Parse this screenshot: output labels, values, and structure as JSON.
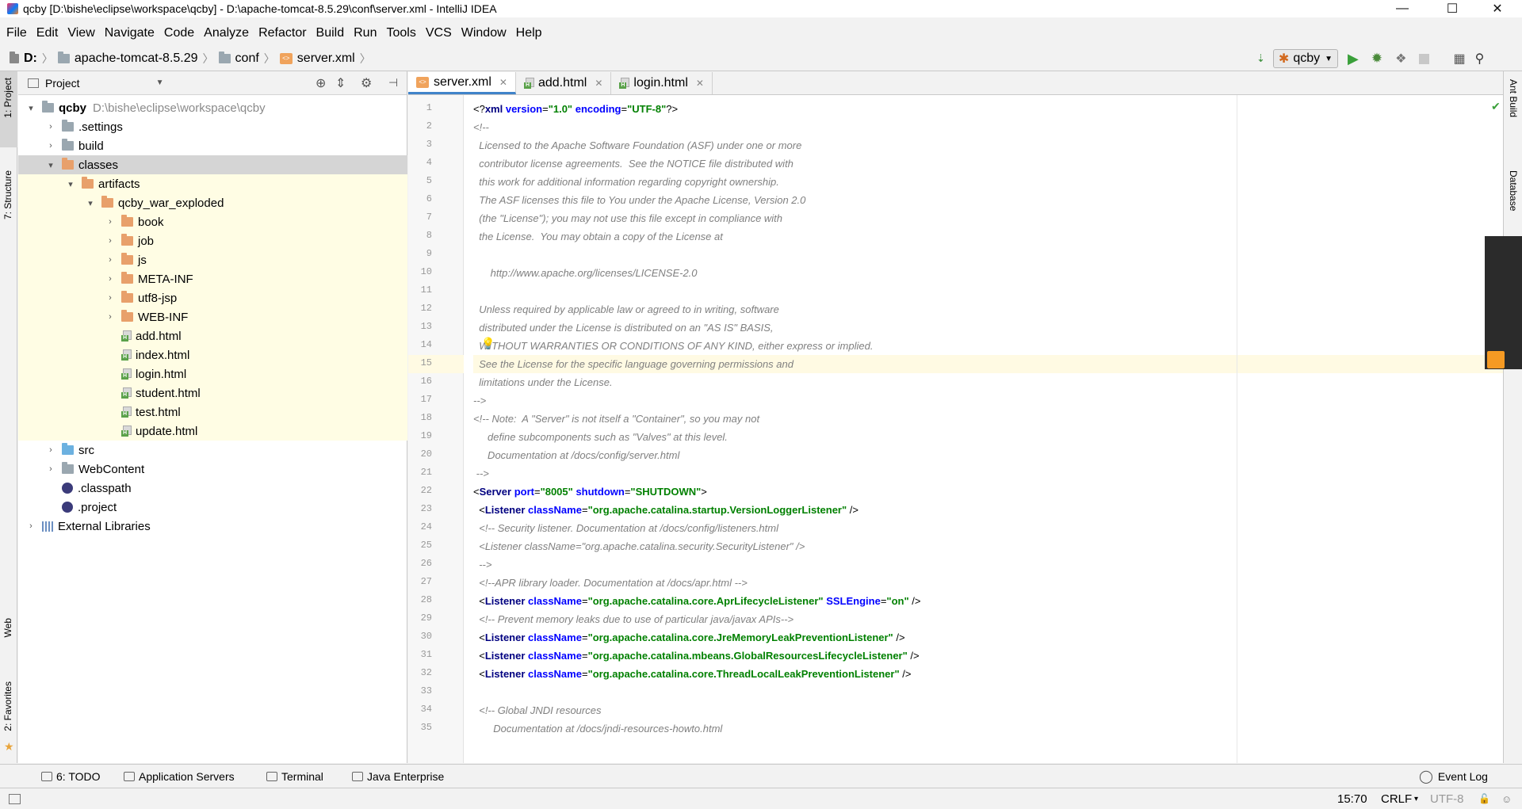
{
  "window": {
    "title": "qcby [D:\\bishe\\eclipse\\workspace\\qcby] - D:\\apache-tomcat-8.5.29\\conf\\server.xml - IntelliJ IDEA",
    "minimize": "—",
    "maximize": "☐",
    "close": "✕"
  },
  "menu": [
    "File",
    "Edit",
    "View",
    "Navigate",
    "Code",
    "Analyze",
    "Refactor",
    "Build",
    "Run",
    "Tools",
    "VCS",
    "Window",
    "Help"
  ],
  "breadcrumb": [
    "D:",
    "apache-tomcat-8.5.29",
    "conf",
    "server.xml"
  ],
  "run_config": "qcby",
  "left_strip": {
    "project": "1: Project",
    "structure": "7: Structure",
    "web": "Web",
    "favorites": "2: Favorites"
  },
  "right_strip": {
    "ant": "Ant Build",
    "database": "Database"
  },
  "project_panel": {
    "title": "Project",
    "tree": [
      {
        "label": "qcby",
        "path": "D:\\bishe\\eclipse\\workspace\\qcby",
        "level": 0,
        "icon": "module-folder-icon",
        "expand": "down",
        "bold": true
      },
      {
        "label": ".settings",
        "level": 1,
        "icon": "folder-icon",
        "expand": "right"
      },
      {
        "label": "build",
        "level": 1,
        "icon": "folder-icon",
        "expand": "right"
      },
      {
        "label": "classes",
        "level": 1,
        "icon": "orange-folder-icon",
        "expand": "down",
        "selected": true
      },
      {
        "label": "artifacts",
        "level": 2,
        "icon": "orange-folder-icon",
        "expand": "down"
      },
      {
        "label": "qcby_war_exploded",
        "level": 3,
        "icon": "orange-folder-icon",
        "expand": "down"
      },
      {
        "label": "book",
        "level": 4,
        "icon": "orange-folder-icon",
        "expand": "right"
      },
      {
        "label": "job",
        "level": 4,
        "icon": "orange-folder-icon",
        "expand": "right"
      },
      {
        "label": "js",
        "level": 4,
        "icon": "orange-folder-icon",
        "expand": "right"
      },
      {
        "label": "META-INF",
        "level": 4,
        "icon": "orange-folder-icon",
        "expand": "right"
      },
      {
        "label": "utf8-jsp",
        "level": 4,
        "icon": "orange-folder-icon",
        "expand": "right"
      },
      {
        "label": "WEB-INF",
        "level": 4,
        "icon": "orange-folder-icon",
        "expand": "right"
      },
      {
        "label": "add.html",
        "level": 4,
        "icon": "html-file-icon"
      },
      {
        "label": "index.html",
        "level": 4,
        "icon": "html-file-icon"
      },
      {
        "label": "login.html",
        "level": 4,
        "icon": "html-file-icon"
      },
      {
        "label": "student.html",
        "level": 4,
        "icon": "html-file-icon"
      },
      {
        "label": "test.html",
        "level": 4,
        "icon": "html-file-icon"
      },
      {
        "label": "update.html",
        "level": 4,
        "icon": "html-file-icon"
      },
      {
        "label": "src",
        "level": 1,
        "icon": "blue-folder-icon",
        "expand": "right"
      },
      {
        "label": "WebContent",
        "level": 1,
        "icon": "folder-icon",
        "expand": "right"
      },
      {
        "label": ".classpath",
        "level": 1,
        "icon": "eclipse-file-icon"
      },
      {
        "label": ".project",
        "level": 1,
        "icon": "eclipse-file-icon"
      },
      {
        "label": "External Libraries",
        "level": 0,
        "icon": "libraries-icon",
        "expand": "right"
      }
    ]
  },
  "tabs": [
    {
      "label": "server.xml",
      "active": true,
      "icon": "xml-file-icon"
    },
    {
      "label": "add.html",
      "active": false,
      "icon": "html-file-icon"
    },
    {
      "label": "login.html",
      "active": false,
      "icon": "html-file-icon"
    }
  ],
  "code_lines": [
    [
      {
        "t": "<?",
        "c": "pl"
      },
      {
        "t": "xml ",
        "c": "tg"
      },
      {
        "t": "version",
        "c": "at"
      },
      {
        "t": "=",
        "c": "pl"
      },
      {
        "t": "\"1.0\"",
        "c": "sv"
      },
      {
        "t": " ",
        "c": "pl"
      },
      {
        "t": "encoding",
        "c": "at"
      },
      {
        "t": "=",
        "c": "pl"
      },
      {
        "t": "\"UTF-8\"",
        "c": "sv"
      },
      {
        "t": "?>",
        "c": "pl"
      }
    ],
    [
      {
        "t": "<!--",
        "c": "cm"
      }
    ],
    [
      {
        "t": "  Licensed to the Apache Software Foundation (ASF) under one or more",
        "c": "cm"
      }
    ],
    [
      {
        "t": "  contributor license agreements.  See the NOTICE file distributed with",
        "c": "cm"
      }
    ],
    [
      {
        "t": "  this work for additional information regarding copyright ownership.",
        "c": "cm"
      }
    ],
    [
      {
        "t": "  The ASF licenses this file to You under the Apache License, Version 2.0",
        "c": "cm"
      }
    ],
    [
      {
        "t": "  (the \"License\"); you may not use this file except in compliance with",
        "c": "cm"
      }
    ],
    [
      {
        "t": "  the License.  You may obtain a copy of the License at",
        "c": "cm"
      }
    ],
    [
      {
        "t": "",
        "c": "cm"
      }
    ],
    [
      {
        "t": "      http://www.apache.org/licenses/LICENSE-2.0",
        "c": "cm"
      }
    ],
    [
      {
        "t": "",
        "c": "cm"
      }
    ],
    [
      {
        "t": "  Unless required by applicable law or agreed to in writing, software",
        "c": "cm"
      }
    ],
    [
      {
        "t": "  distributed under the License is distributed on an \"AS IS\" BASIS,",
        "c": "cm"
      }
    ],
    [
      {
        "t": "  WITHOUT WARRANTIES OR CONDITIONS OF ANY KIND, either express or implied.",
        "c": "cm"
      }
    ],
    [
      {
        "t": "  See the License for the specific language governing permissions and",
        "c": "cm"
      }
    ],
    [
      {
        "t": "  limitations under the License.",
        "c": "cm"
      }
    ],
    [
      {
        "t": "-->",
        "c": "cm"
      }
    ],
    [
      {
        "t": "<!-- Note:  A \"Server\" is not itself a \"Container\", so you may not",
        "c": "cm"
      }
    ],
    [
      {
        "t": "     define subcomponents such as \"Valves\" at this level.",
        "c": "cm"
      }
    ],
    [
      {
        "t": "     Documentation at /docs/config/server.html",
        "c": "cm"
      }
    ],
    [
      {
        "t": " -->",
        "c": "cm"
      }
    ],
    [
      {
        "t": "<",
        "c": "pl"
      },
      {
        "t": "Server ",
        "c": "tg"
      },
      {
        "t": "port",
        "c": "at"
      },
      {
        "t": "=",
        "c": "pl"
      },
      {
        "t": "\"8005\"",
        "c": "sv"
      },
      {
        "t": " ",
        "c": "pl"
      },
      {
        "t": "shutdown",
        "c": "at"
      },
      {
        "t": "=",
        "c": "pl"
      },
      {
        "t": "\"SHUTDOWN\"",
        "c": "sv"
      },
      {
        "t": ">",
        "c": "pl"
      }
    ],
    [
      {
        "t": "  <",
        "c": "pl"
      },
      {
        "t": "Listener ",
        "c": "tg"
      },
      {
        "t": "className",
        "c": "at"
      },
      {
        "t": "=",
        "c": "pl"
      },
      {
        "t": "\"org.apache.catalina.startup.VersionLoggerListener\"",
        "c": "sv"
      },
      {
        "t": " />",
        "c": "pl"
      }
    ],
    [
      {
        "t": "  <!-- Security listener. Documentation at /docs/config/listeners.html",
        "c": "cm"
      }
    ],
    [
      {
        "t": "  <Listener className=\"org.apache.catalina.security.SecurityListener\" />",
        "c": "cm"
      }
    ],
    [
      {
        "t": "  -->",
        "c": "cm"
      }
    ],
    [
      {
        "t": "  <!--APR library loader. Documentation at /docs/apr.html -->",
        "c": "cm"
      }
    ],
    [
      {
        "t": "  <",
        "c": "pl"
      },
      {
        "t": "Listener ",
        "c": "tg"
      },
      {
        "t": "className",
        "c": "at"
      },
      {
        "t": "=",
        "c": "pl"
      },
      {
        "t": "\"org.apache.catalina.core.AprLifecycleListener\"",
        "c": "sv"
      },
      {
        "t": " ",
        "c": "pl"
      },
      {
        "t": "SSLEngine",
        "c": "at"
      },
      {
        "t": "=",
        "c": "pl"
      },
      {
        "t": "\"on\"",
        "c": "sv"
      },
      {
        "t": " />",
        "c": "pl"
      }
    ],
    [
      {
        "t": "  <!-- Prevent memory leaks due to use of particular java/javax APIs-->",
        "c": "cm"
      }
    ],
    [
      {
        "t": "  <",
        "c": "pl"
      },
      {
        "t": "Listener ",
        "c": "tg"
      },
      {
        "t": "className",
        "c": "at"
      },
      {
        "t": "=",
        "c": "pl"
      },
      {
        "t": "\"org.apache.catalina.core.JreMemoryLeakPreventionListener\"",
        "c": "sv"
      },
      {
        "t": " />",
        "c": "pl"
      }
    ],
    [
      {
        "t": "  <",
        "c": "pl"
      },
      {
        "t": "Listener ",
        "c": "tg"
      },
      {
        "t": "className",
        "c": "at"
      },
      {
        "t": "=",
        "c": "pl"
      },
      {
        "t": "\"org.apache.catalina.mbeans.GlobalResourcesLifecycleListener\"",
        "c": "sv"
      },
      {
        "t": " />",
        "c": "pl"
      }
    ],
    [
      {
        "t": "  <",
        "c": "pl"
      },
      {
        "t": "Listener ",
        "c": "tg"
      },
      {
        "t": "className",
        "c": "at"
      },
      {
        "t": "=",
        "c": "pl"
      },
      {
        "t": "\"org.apache.catalina.core.ThreadLocalLeakPreventionListener\"",
        "c": "sv"
      },
      {
        "t": " />",
        "c": "pl"
      }
    ],
    [
      {
        "t": "",
        "c": "pl"
      }
    ],
    [
      {
        "t": "  <!-- Global JNDI resources",
        "c": "cm"
      }
    ],
    [
      {
        "t": "       Documentation at /docs/jndi-resources-howto.html",
        "c": "cm"
      }
    ]
  ],
  "current_line": 15,
  "bottom_tools": [
    {
      "label": "6: TODO",
      "icon": "todo-icon"
    },
    {
      "label": "Application Servers",
      "icon": "app-servers-icon"
    },
    {
      "label": "Terminal",
      "icon": "terminal-icon"
    },
    {
      "label": "Java Enterprise",
      "icon": "java-enterprise-icon"
    }
  ],
  "event_log": "Event Log",
  "status": {
    "position": "15:70",
    "line_sep": "CRLF",
    "encoding": "UTF-8"
  }
}
